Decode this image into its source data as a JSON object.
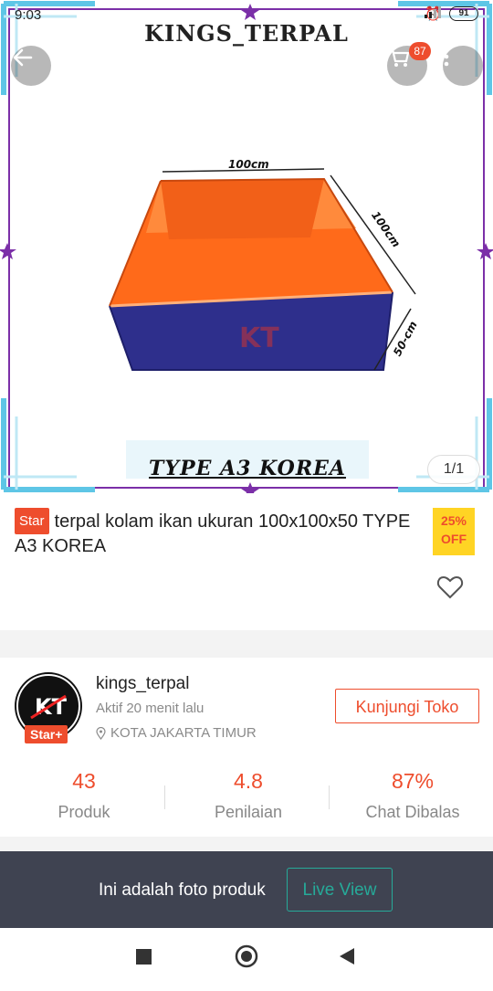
{
  "status_bar": {
    "time": "9:03",
    "battery": "91"
  },
  "header": {
    "store_brand": "KINGS_TERPAL",
    "cart_count": "87"
  },
  "product_image": {
    "dim_width": "100cm",
    "dim_depth": "100cm",
    "dim_height": "50-cm",
    "logo_text": "KT",
    "type_label": "TYPE A3 KOREA",
    "pager": "1/1"
  },
  "product": {
    "star_badge": "Star",
    "title": "terpal kolam ikan ukuran 100x100x50 TYPE A3 KOREA",
    "discount_pct": "25%",
    "discount_off": "OFF"
  },
  "shop": {
    "name": "kings_terpal",
    "active": "Aktif 20 menit lalu",
    "location": "KOTA JAKARTA TIMUR",
    "badge": "Star+",
    "avatar_text": "KT",
    "visit_label": "Kunjungi Toko",
    "stats": [
      {
        "value": "43",
        "label": "Produk"
      },
      {
        "value": "4.8",
        "label": "Penilaian"
      },
      {
        "value": "87%",
        "label": "Chat Dibalas"
      }
    ]
  },
  "live_bar": {
    "text": "Ini adalah foto produk",
    "button": "Live View"
  },
  "colors": {
    "accent": "#ee4d2d",
    "teal": "#26aa99",
    "dark_bar": "#3f4351",
    "discount_bg": "#ffd424",
    "frame_purple": "#7b2fa8",
    "frame_cyan": "#5ec6e6"
  }
}
